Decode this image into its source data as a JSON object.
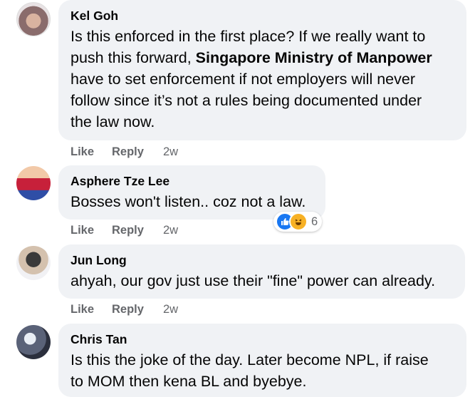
{
  "comments": [
    {
      "author": "Kel Goh",
      "lines": [
        "Is this enforced in the first place? If we really want to",
        "push this forward, ",
        "Singapore Ministry of Manpower",
        "have to set enforcement if not employers will never",
        "follow since it’s not a rules being documented under",
        "the law now."
      ],
      "time": "2w"
    },
    {
      "author": "Asphere Tze Lee",
      "text": "Bosses won't listen.. coz not a law.",
      "time": "2w",
      "reaction_count": "6"
    },
    {
      "author": "Jun Long",
      "text": "ahyah, our gov just use their \"fine\" power can already.",
      "time": "2w"
    },
    {
      "author": "Chris Tan",
      "lines": [
        "Is this the joke of the day. Later become NPL, if raise",
        "to MOM then kena BL and byebye."
      ]
    }
  ],
  "actions": {
    "like": "Like",
    "reply": "Reply"
  },
  "colors": {
    "bubble": "#f0f2f5",
    "meta": "#65676b",
    "like_blue": "#1877f2",
    "haha_yellow": "#f7b125"
  },
  "icons": {
    "like": "thumbs-up-icon",
    "haha": "laughing-face-icon"
  }
}
